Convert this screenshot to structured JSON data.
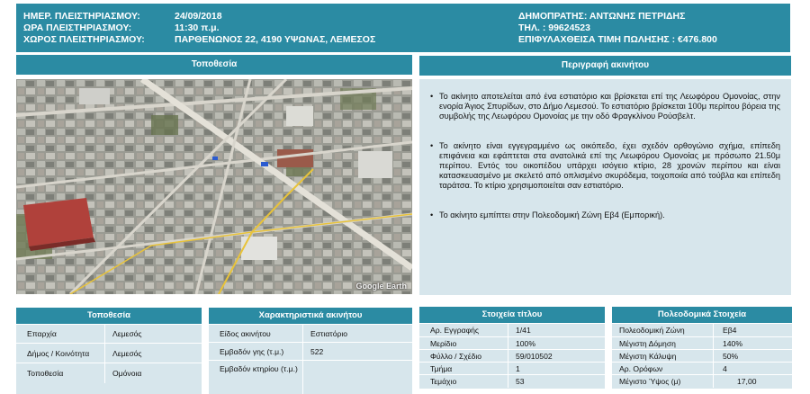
{
  "header": {
    "auction_date_label": "ΗΜΕΡ. ΠΛΕΙΣΤΗΡΙΑΣΜΟΥ:",
    "auction_date_value": "24/09/2018",
    "auction_time_label": "ΩΡΑ ΠΛΕΙΣΤΗΡΙΑΣΜΟΥ:",
    "auction_time_value": "11:30 π.μ.",
    "auction_place_label": "ΧΩΡΟΣ ΠΛΕΙΣΤΗΡΙΑΣΜΟΥ:",
    "auction_place_value": "ΠΑΡΘΕΝΩΝΟΣ 22, 4190 ΥΨΩΝΑΣ, ΛΕΜΕΣΟΣ",
    "auctioneer": "ΔΗΜΟΠΡΑΤΗΣ: ΑΝΤΩΝΗΣ ΠΕΤΡΙΔΗΣ",
    "phone": "ΤΗΛ. : 99624523",
    "reserve_price": "ΕΠΙΦΥΛΑΧΘΕΙΣΑ ΤΙΜΗ ΠΩΛΗΣΗΣ : €476.800"
  },
  "location_title": "Τοποθεσία",
  "map_credit": "Google Earth",
  "description": {
    "title": "Περιγραφή ακινήτου",
    "paragraphs": [
      "Το ακίνητο αποτελείται από ένα εστιατόριο και βρίσκεται επί της Λεωφόρου Ομονοίας, στην ενορία Άγιος Σπυρίδων, στο Δήμο Λεμεσού. Το εστιατόριο βρίσκεται 100μ περίπου βόρεια της συμβολής της Λεωφόρου Ομονοίας με την οδό Φραγκλίνου Ρούσβελτ.",
      "Το ακίνητο είναι εγγεγραμμένο ως οικόπεδο, έχει σχεδόν ορθογώνιο σχήμα, επίπεδη επιφάνεια και εφάπτεται στα ανατολικά επί της Λεωφόρου Ομονοίας με πρόσωπο 21.50μ περίπου. Εντός του οικοπέδου υπάρχει ισόγειο κτίριο, 28 χρονών περίπου και είναι κατασκευασμένο με σκελετό από οπλισμένο σκυρόδεμα, τοιχοποιία από τούβλα και επίπεδη ταράτσα. Το κτίριο χρησιμοποιείται σαν εστιατόριο.",
      "Το ακίνητο εμπίπτει στην Πολεοδομική Ζώνη Εβ4 (Εμπορική)."
    ]
  },
  "location_table": {
    "title": "Τοποθεσία",
    "rows": [
      {
        "label": "Επαρχία",
        "value": "Λεμεσός"
      },
      {
        "label": "Δήμος / Κοινότητα",
        "value": "Λεμεσός"
      },
      {
        "label": "Τοποθεσία",
        "value": "Ομόνοια"
      }
    ]
  },
  "features_table": {
    "title": "Χαρακτηριστικά ακινήτου",
    "rows": [
      {
        "label": "Είδος ακινήτου",
        "value": "Εστιατόριο"
      },
      {
        "label": "Εμβαδόν γης (τ.μ.)",
        "value": "522"
      },
      {
        "label": "Εμβαδόν κτηρίου (τ.μ.)",
        "value": ""
      }
    ]
  },
  "title_table": {
    "title": "Στοιχεία τίτλου",
    "rows": [
      {
        "label": "Αρ. Εγγραφής",
        "value": "1/41"
      },
      {
        "label": "Μερίδιο",
        "value": "100%"
      },
      {
        "label": "Φύλλο / Σχέδιο",
        "value": "59/010502"
      },
      {
        "label": "Τμήμα",
        "value": "1"
      },
      {
        "label": "Τεμάχιο",
        "value": "53"
      }
    ]
  },
  "planning_table": {
    "title": "Πολεοδομικά Στοιχεία",
    "rows": [
      {
        "label": "Πολεοδομική Ζώνη",
        "value": "Εβ4"
      },
      {
        "label": "Μέγιστη Δόμηση",
        "value": "140%"
      },
      {
        "label": "Μέγιστη Κάλυψη",
        "value": "50%"
      },
      {
        "label": "Αρ. Ορόφων",
        "value": "4"
      },
      {
        "label": "Μέγιστο Ύψος (μ)",
        "value": "17,00"
      }
    ]
  }
}
